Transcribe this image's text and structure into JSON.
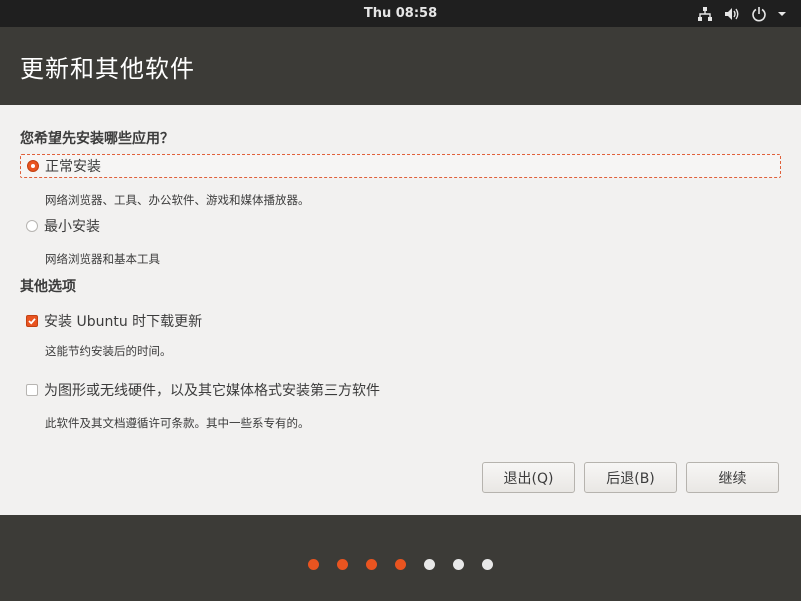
{
  "topbar": {
    "clock": "Thu 08:58",
    "icons": [
      "network-icon",
      "volume-icon",
      "power-icon",
      "menu-arrow-icon"
    ]
  },
  "header": {
    "title": "更新和其他软件"
  },
  "install_section": {
    "question": "您希望先安装哪些应用？",
    "options": [
      {
        "label": "正常安装",
        "description": "网络浏览器、工具、办公软件、游戏和媒体播放器。",
        "selected": true
      },
      {
        "label": "最小安装",
        "description": "网络浏览器和基本工具",
        "selected": false
      }
    ]
  },
  "other_section": {
    "title": "其他选项",
    "options": [
      {
        "label": "安装 Ubuntu 时下载更新",
        "description": "这能节约安装后的时间。",
        "checked": true
      },
      {
        "label": "为图形或无线硬件，以及其它媒体格式安装第三方软件",
        "description": "此软件及其文档遵循许可条款。其中一些系专有的。",
        "checked": false
      }
    ]
  },
  "buttons": {
    "quit": "退出(Q)",
    "back": "后退(B)",
    "continue": "继续"
  },
  "progress": {
    "total_steps": 7,
    "completed_steps": 4,
    "active_color": "#e95420",
    "inactive_color": "#e8e8e8"
  },
  "colors": {
    "accent": "#e95420",
    "dark_bg": "#3c3b37",
    "panel_bg": "#f2f1f0"
  }
}
